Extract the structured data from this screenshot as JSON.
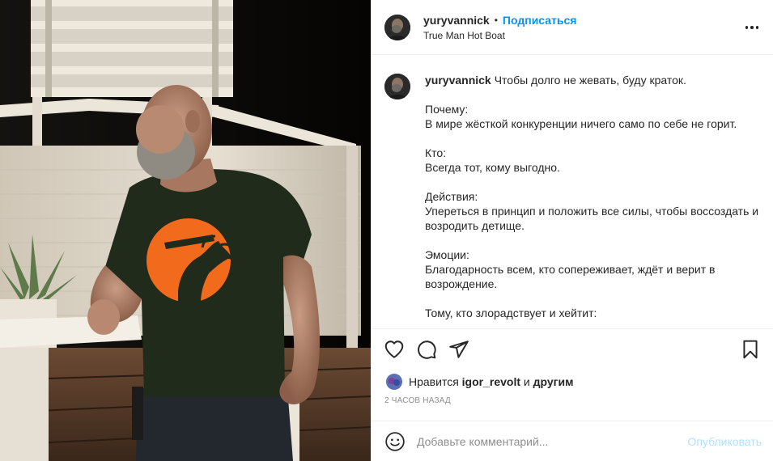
{
  "header": {
    "username": "yuryvannick",
    "separator": "•",
    "follow_label": "Подписаться",
    "location": "True Man Hot Boat"
  },
  "caption": {
    "username": "yuryvannick",
    "lines": [
      "Чтобы долго не жевать, буду краток.",
      "",
      "Почему:",
      "В мире жёсткой конкуренции ничего само по себе не горит.",
      "",
      "Кто:",
      "Всегда тот, кому выгодно.",
      "",
      "Действия:",
      "Упереться в принцип и положить все силы, чтобы воссоздать и возродить детище.",
      "",
      "Эмоции:",
      "Благодарность всем, кто сопереживает, ждёт и верит в возрождение.",
      "",
      "Тому, кто злорадствует и хейтит:"
    ]
  },
  "actions": {
    "like_icon": "heart-icon",
    "comment_icon": "comment-icon",
    "share_icon": "paper-plane-icon",
    "save_icon": "bookmark-icon"
  },
  "likes": {
    "prefix": "Нравится",
    "user": "igor_revolt",
    "connector": "и",
    "others": "другим"
  },
  "timestamp": "2 часов назад",
  "add_comment": {
    "placeholder": "Добавьте комментарий...",
    "publish_label": "Опубликовать"
  },
  "colors": {
    "accent": "#0095f6",
    "publish_disabled": "#b2dffc",
    "shirt_print": "#f26a1b",
    "shirt": "#1f2a1a"
  }
}
